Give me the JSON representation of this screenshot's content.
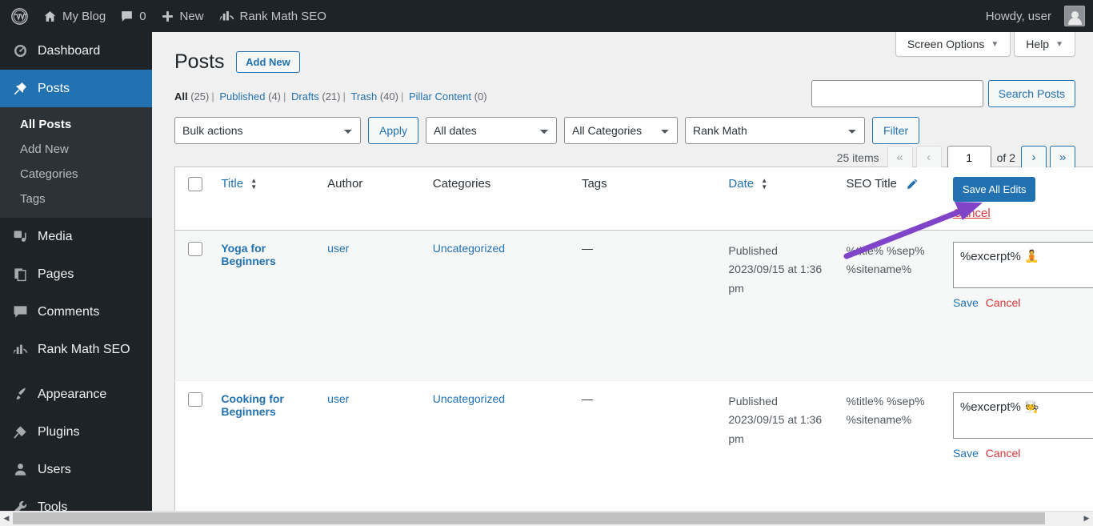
{
  "adminbar": {
    "site_name": "My Blog",
    "comments_count": "0",
    "new_label": "New",
    "rankmath_label": "Rank Math SEO",
    "howdy": "Howdy, user",
    "icons": {
      "wp": "wordpress-logo-icon",
      "home": "home-icon",
      "comment": "comment-bubble-icon",
      "plus": "plus-icon",
      "rankmath": "rank-math-icon",
      "avatar": "avatar-icon"
    }
  },
  "sidebar": {
    "items": [
      {
        "label": "Dashboard",
        "icon": "dashboard-icon",
        "current": false
      },
      {
        "label": "Posts",
        "icon": "pin-icon",
        "current": true
      },
      {
        "label": "Media",
        "icon": "media-icon",
        "current": false
      },
      {
        "label": "Pages",
        "icon": "pages-icon",
        "current": false
      },
      {
        "label": "Comments",
        "icon": "comments-icon",
        "current": false
      },
      {
        "label": "Rank Math SEO",
        "icon": "rank-math-icon",
        "current": false
      },
      {
        "label": "Appearance",
        "icon": "appearance-brush-icon",
        "current": false
      },
      {
        "label": "Plugins",
        "icon": "plugin-icon",
        "current": false
      },
      {
        "label": "Users",
        "icon": "users-icon",
        "current": false
      },
      {
        "label": "Tools",
        "icon": "tools-wrench-icon",
        "current": false
      }
    ],
    "posts_submenu": [
      {
        "label": "All Posts",
        "current": true
      },
      {
        "label": "Add New",
        "current": false
      },
      {
        "label": "Categories",
        "current": false
      },
      {
        "label": "Tags",
        "current": false
      }
    ]
  },
  "screen_meta": {
    "screen_options": "Screen Options",
    "help": "Help",
    "caret": "▼"
  },
  "header": {
    "title": "Posts",
    "add_new": "Add New"
  },
  "subsubsub": [
    {
      "label": "All",
      "count": "(25)",
      "current": true
    },
    {
      "label": "Published",
      "count": "(4)",
      "current": false
    },
    {
      "label": "Drafts",
      "count": "(21)",
      "current": false
    },
    {
      "label": "Trash",
      "count": "(40)",
      "current": false
    },
    {
      "label": "Pillar Content",
      "count": "(0)",
      "current": false
    }
  ],
  "search": {
    "value": "",
    "placeholder": "",
    "button": "Search Posts"
  },
  "filters": {
    "bulk_actions": "Bulk actions",
    "apply": "Apply",
    "all_dates": "All dates",
    "all_categories": "All Categories",
    "rank_math": "Rank Math",
    "filter": "Filter"
  },
  "pagination": {
    "items": "25 items",
    "first": "«",
    "prev": "‹",
    "current_page": "1",
    "of_total": "of 2",
    "next": "›",
    "last": "»"
  },
  "table": {
    "columns": {
      "title": "Title",
      "author": "Author",
      "categories": "Categories",
      "tags": "Tags",
      "date": "Date",
      "seo_title": "SEO Title",
      "seo_description": ""
    },
    "bulk_edit": {
      "save_all": "Save All Edits",
      "cancel_all": "Cancel"
    },
    "rows": [
      {
        "title": "Yoga for Beginners",
        "author": "user",
        "categories": "Uncategorized",
        "tags": "—",
        "date_status": "Published",
        "date_value": "2023/09/15 at 1:36 pm",
        "seo_title": "%title% %sep% %sitename%",
        "seo_description": "%excerpt% 🧘",
        "save": "Save",
        "cancel": "Cancel"
      },
      {
        "title": "Cooking for Beginners",
        "author": "user",
        "categories": "Uncategorized",
        "tags": "—",
        "date_status": "Published",
        "date_value": "2023/09/15 at 1:36 pm",
        "seo_title": "%title% %sep% %sitename%",
        "seo_description": "%excerpt% 🧑‍🍳",
        "save": "Save",
        "cancel": "Cancel"
      }
    ]
  },
  "colors": {
    "accent": "#2271b1",
    "admin_dark": "#1d2327",
    "danger": "#d63638",
    "annotation": "#8044c8"
  }
}
